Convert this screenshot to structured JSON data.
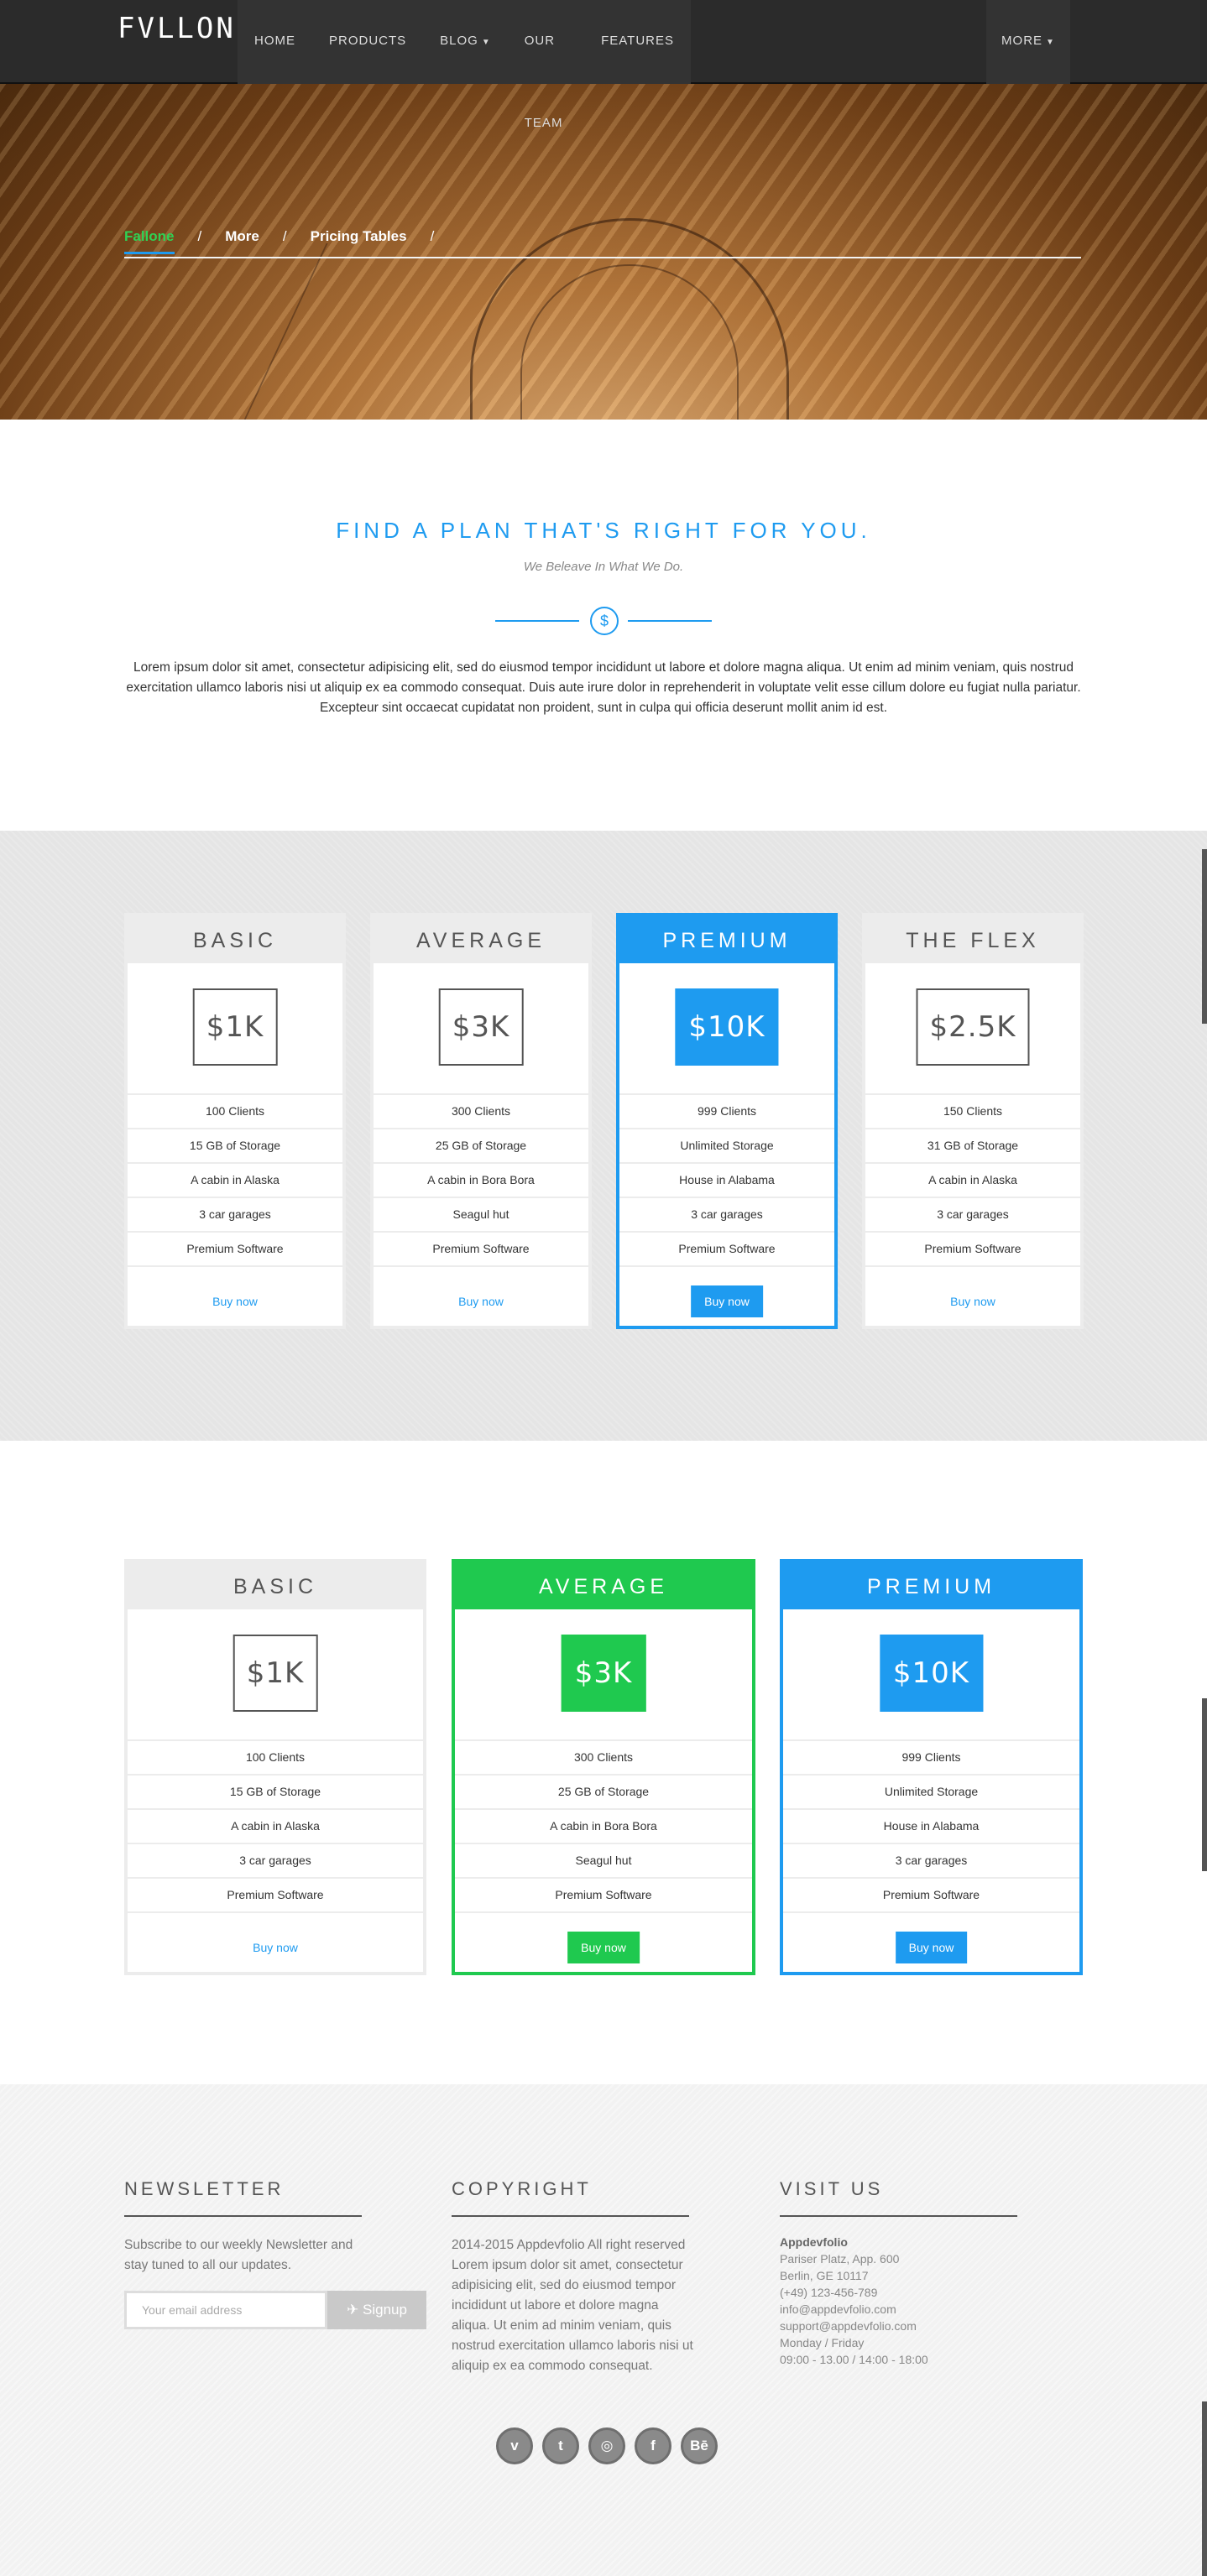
{
  "nav": {
    "logo": "FVLLONE",
    "items": [
      "HOME",
      "PRODUCTS",
      "BLOG",
      "OUR TEAM",
      "FEATURES"
    ],
    "more": "MORE"
  },
  "breadcrumb": {
    "items": [
      "Fallone",
      "More",
      "Pricing Tables"
    ],
    "sep": "/"
  },
  "intro": {
    "title": "FIND A PLAN THAT'S RIGHT FOR YOU.",
    "subtitle": "We Beleave In What We Do.",
    "icon": "$",
    "text": "Lorem ipsum dolor sit amet, consectetur adipisicing elit, sed do eiusmod tempor incididunt ut labore et dolore magna aliqua. Ut enim ad minim veniam, quis nostrud exercitation ullamco laboris nisi ut aliquip ex ea commodo consequat. Duis aute irure dolor in reprehenderit in voluptate velit esse cillum dolore eu fugiat nulla pariatur. Excepteur sint occaecat cupidatat non proident, sunt in culpa qui officia deserunt mollit anim id est."
  },
  "pricing1": [
    {
      "title": "BASIC",
      "price": "$1K",
      "features": [
        "100 Clients",
        "15 GB of Storage",
        "A cabin in Alaska",
        "3 car garages",
        "Premium Software"
      ],
      "button": "Buy now"
    },
    {
      "title": "AVERAGE",
      "price": "$3K",
      "features": [
        "300 Clients",
        "25 GB of Storage",
        "A cabin in Bora Bora",
        "Seagul hut",
        "Premium Software"
      ],
      "button": "Buy now"
    },
    {
      "title": "PREMIUM",
      "price": "$10K",
      "features": [
        "999 Clients",
        "Unlimited Storage",
        "House in Alabama",
        "3 car garages",
        "Premium Software"
      ],
      "button": "Buy now"
    },
    {
      "title": "THE FLEX",
      "price": "$2.5K",
      "features": [
        "150 Clients",
        "31 GB of Storage",
        "A cabin in Alaska",
        "3 car garages",
        "Premium Software"
      ],
      "button": "Buy now"
    }
  ],
  "pricing2": [
    {
      "title": "BASIC",
      "price": "$1K",
      "features": [
        "100 Clients",
        "15 GB of Storage",
        "A cabin in Alaska",
        "3 car garages",
        "Premium Software"
      ],
      "button": "Buy now"
    },
    {
      "title": "AVERAGE",
      "price": "$3K",
      "features": [
        "300 Clients",
        "25 GB of Storage",
        "A cabin in Bora Bora",
        "Seagul hut",
        "Premium Software"
      ],
      "button": "Buy now"
    },
    {
      "title": "PREMIUM",
      "price": "$10K",
      "features": [
        "999 Clients",
        "Unlimited Storage",
        "House in Alabama",
        "3 car garages",
        "Premium Software"
      ],
      "button": "Buy now"
    }
  ],
  "footer": {
    "newsletter": {
      "title": "NEWSLETTER",
      "text": "Subscribe to our weekly Newsletter and stay tuned to all our updates.",
      "placeholder": "Your email address",
      "button": "Signup"
    },
    "copyright": {
      "title": "COPYRIGHT",
      "text": "2014-2015 Appdevfolio All right reserved Lorem ipsum dolor sit amet, consectetur adipisicing elit, sed do eiusmod tempor incididunt ut labore et dolore magna aliqua. Ut enim ad minim veniam, quis nostrud exercitation ullamco laboris nisi ut aliquip ex ea commodo consequat."
    },
    "visit": {
      "title": "VISIT US",
      "company": "Appdevfolio",
      "lines": [
        "Pariser Platz, App. 600",
        "Berlin, GE 10117",
        "(+49) 123-456-789",
        "info@appdevfolio.com",
        "support@appdevfolio.com",
        "Monday / Friday",
        "09:00 - 13.00 / 14:00 - 18:00"
      ]
    },
    "socials": [
      {
        "icon": "vimeo-icon",
        "glyph": "v"
      },
      {
        "icon": "twitter-icon",
        "glyph": "t"
      },
      {
        "icon": "instagram-icon",
        "glyph": "◎"
      },
      {
        "icon": "facebook-icon",
        "glyph": "f"
      },
      {
        "icon": "behance-icon",
        "glyph": "Bē"
      }
    ]
  },
  "colors": {
    "accent": "#1e9bf0",
    "green": "#1fc94f",
    "nav": "#2b2b2b"
  }
}
